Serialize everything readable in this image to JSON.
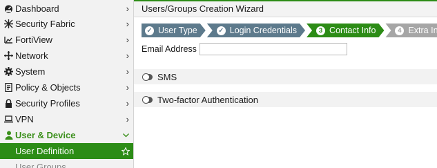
{
  "sidebar": {
    "items": [
      {
        "label": "Dashboard",
        "icon": "dashboard-icon"
      },
      {
        "label": "Security Fabric",
        "icon": "security-fabric-icon"
      },
      {
        "label": "FortiView",
        "icon": "fortiview-icon"
      },
      {
        "label": "Network",
        "icon": "network-icon"
      },
      {
        "label": "System",
        "icon": "gear-icon"
      },
      {
        "label": "Policy & Objects",
        "icon": "policy-icon"
      },
      {
        "label": "Security Profiles",
        "icon": "lock-icon"
      },
      {
        "label": "VPN",
        "icon": "vpn-icon"
      },
      {
        "label": "User & Device",
        "icon": "user-icon"
      },
      {
        "label": "User Definition"
      },
      {
        "label": "User Groups"
      }
    ]
  },
  "wizard": {
    "title": "Users/Groups Creation Wizard",
    "steps": [
      {
        "label": "User Type",
        "badge": "✓",
        "state": "done"
      },
      {
        "label": "Login Credentials",
        "badge": "✓",
        "state": "done"
      },
      {
        "label": "Contact Info",
        "badge": "3",
        "state": "current"
      },
      {
        "label": "Extra Info",
        "badge": "4",
        "state": "todo"
      }
    ],
    "email": {
      "label": "Email Address",
      "value": "",
      "placeholder": ""
    },
    "sms": {
      "label": "SMS",
      "enabled": false
    },
    "two_factor": {
      "label": "Two-factor Authentication",
      "enabled": false
    }
  },
  "colors": {
    "accent_green": "#2c8c16",
    "step_done": "#5d7a8c",
    "step_todo": "#a6a6a6"
  }
}
